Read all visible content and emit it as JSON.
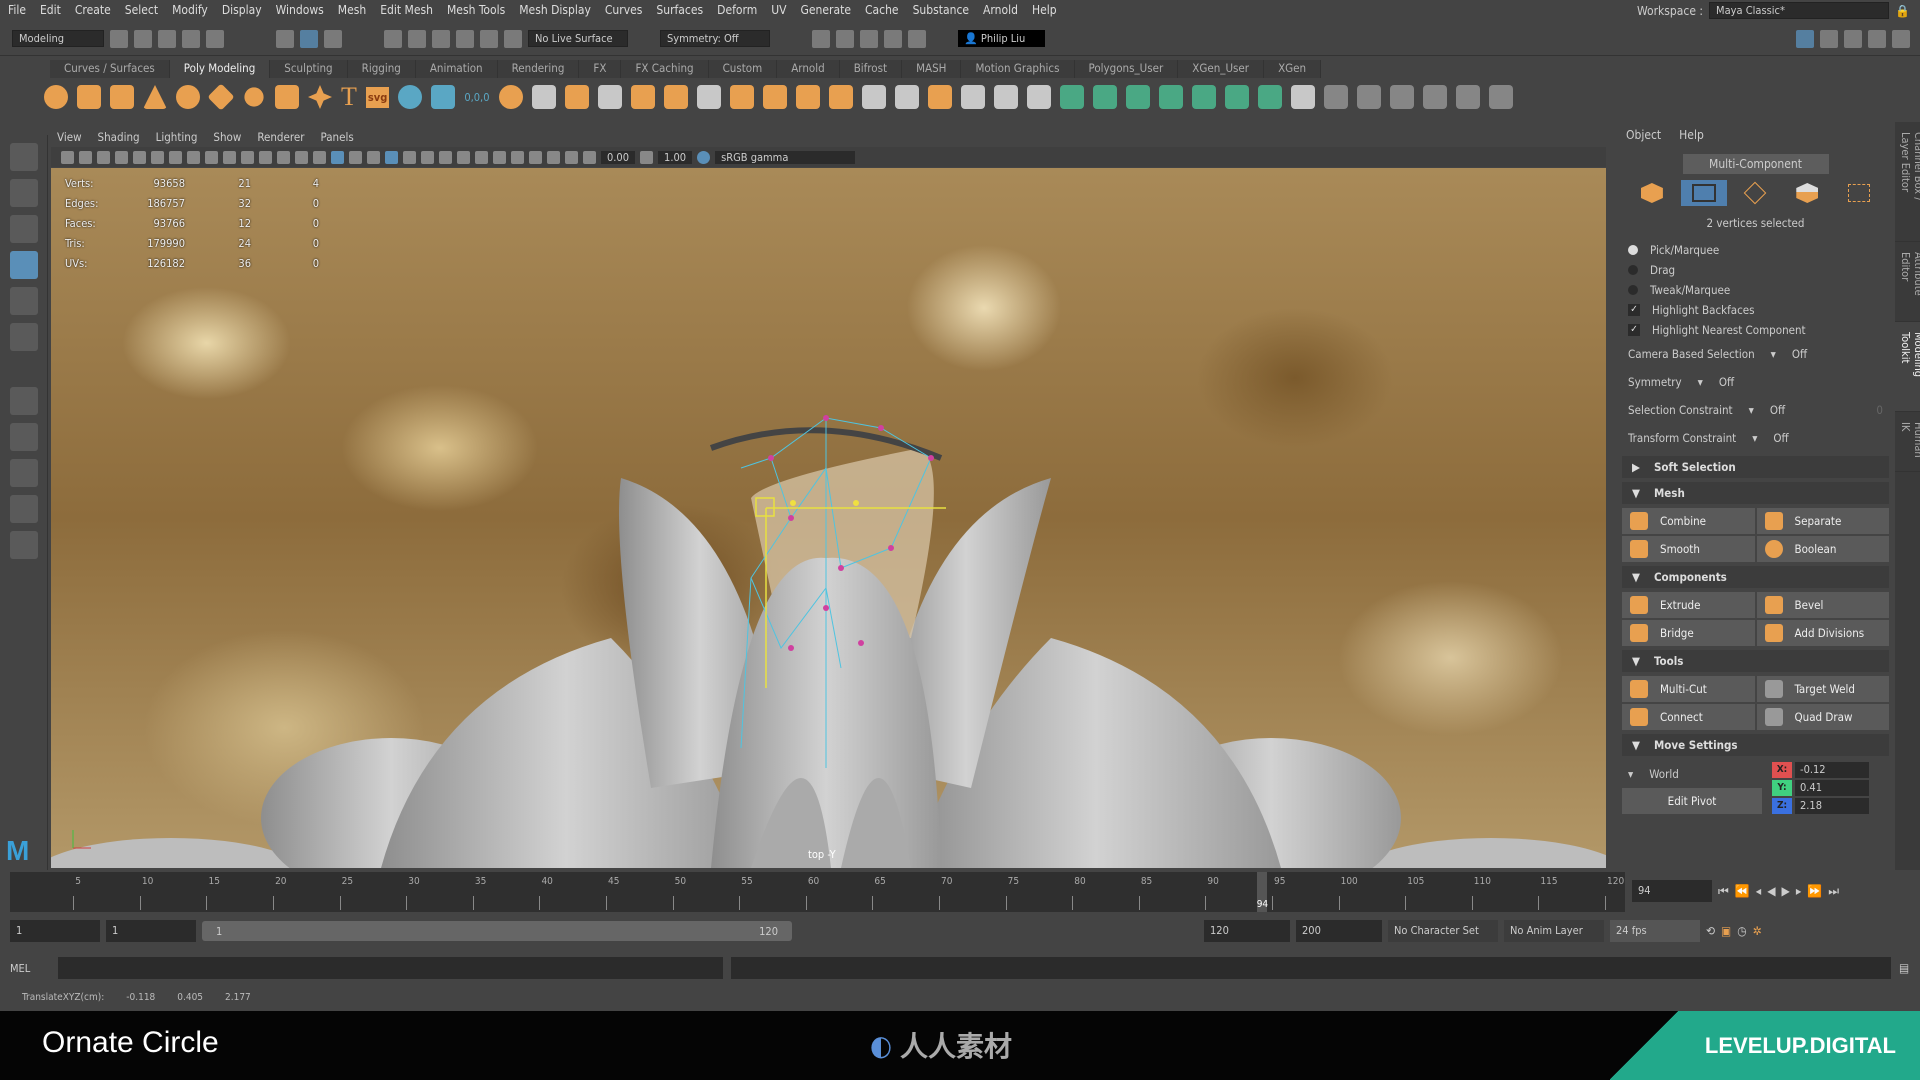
{
  "menubar": {
    "items": [
      "File",
      "Edit",
      "Create",
      "Select",
      "Modify",
      "Display",
      "Windows",
      "Mesh",
      "Edit Mesh",
      "Mesh Tools",
      "Mesh Display",
      "Curves",
      "Surfaces",
      "Deform",
      "UV",
      "Generate",
      "Cache",
      "Substance",
      "Arnold",
      "Help"
    ],
    "workspace_label": "Workspace :",
    "workspace_value": "Maya Classic*"
  },
  "statusline": {
    "mode": "Modeling",
    "live_surface": "No Live Surface",
    "symmetry": "Symmetry: Off",
    "user": "Philip Liu"
  },
  "shelf": {
    "tabs": [
      "Curves / Surfaces",
      "Poly Modeling",
      "Sculpting",
      "Rigging",
      "Animation",
      "Rendering",
      "FX",
      "FX Caching",
      "Custom",
      "Arnold",
      "Bifrost",
      "MASH",
      "Motion Graphics",
      "Polygons_User",
      "XGen_User",
      "XGen"
    ],
    "active": "Poly Modeling",
    "svg_label": "svg",
    "text_label": "T",
    "origin_label": "0,0,0"
  },
  "viewport": {
    "menu": [
      "View",
      "Shading",
      "Lighting",
      "Show",
      "Renderer",
      "Panels"
    ],
    "exposure": "0.00",
    "gamma": "1.00",
    "colorspace": "sRGB gamma",
    "camera": "top -Y",
    "hud": [
      [
        "Verts:",
        "93658",
        "21",
        "4"
      ],
      [
        "Edges:",
        "186757",
        "32",
        "0"
      ],
      [
        "Faces:",
        "93766",
        "12",
        "0"
      ],
      [
        "Tris:",
        "179990",
        "24",
        "0"
      ],
      [
        "UVs:",
        "126182",
        "36",
        "0"
      ]
    ]
  },
  "toolkit": {
    "menu": [
      "Object",
      "Help"
    ],
    "multi_component": "Multi-Component",
    "selection_info": "2 vertices selected",
    "modes": [
      {
        "label": "Pick/Marquee",
        "on": true
      },
      {
        "label": "Drag",
        "on": false
      },
      {
        "label": "Tweak/Marquee",
        "on": false
      }
    ],
    "checks": [
      {
        "label": "Highlight Backfaces",
        "checked": true
      },
      {
        "label": "Highlight Nearest Component",
        "checked": true
      }
    ],
    "options": [
      {
        "label": "Camera Based Selection",
        "value": "Off"
      },
      {
        "label": "Symmetry",
        "value": "Off"
      },
      {
        "label": "Selection Constraint",
        "value": "Off",
        "extra": "0"
      },
      {
        "label": "Transform Constraint",
        "value": "Off"
      }
    ],
    "soft_selection": "Soft Selection",
    "mesh": {
      "title": "Mesh",
      "buttons": [
        "Combine",
        "Separate",
        "Smooth",
        "Boolean"
      ]
    },
    "components": {
      "title": "Components",
      "buttons": [
        "Extrude",
        "Bevel",
        "Bridge",
        "Add Divisions"
      ]
    },
    "tools": {
      "title": "Tools",
      "buttons": [
        "Multi-Cut",
        "Target Weld",
        "Connect",
        "Quad Draw"
      ]
    },
    "move": {
      "title": "Move Settings",
      "space": "World",
      "edit_pivot": "Edit Pivot",
      "x_label": "X:",
      "y_label": "Y:",
      "z_label": "Z:",
      "x": "-0.12",
      "y": "0.41",
      "z": "2.18"
    },
    "side_tabs": [
      "Channel Box / Layer Editor",
      "Attribute Editor",
      "Modeling Toolkit",
      "Human IK"
    ],
    "active_side_tab": "Modeling Toolkit"
  },
  "timeline": {
    "ticks": [
      "5",
      "10",
      "15",
      "20",
      "25",
      "30",
      "35",
      "40",
      "45",
      "50",
      "55",
      "60",
      "65",
      "70",
      "75",
      "80",
      "85",
      "90",
      "95",
      "100",
      "105",
      "110",
      "115",
      "120"
    ],
    "current": "94",
    "current_field": "94",
    "start": 1,
    "end": 120
  },
  "range": {
    "start": "1",
    "playback_start": "1",
    "slider_start": "1",
    "slider_end": "120",
    "playback_end": "120",
    "end": "200",
    "character_set": "No Character Set",
    "anim_layer": "No Anim Layer",
    "fps": "24 fps"
  },
  "mel": {
    "label": "MEL"
  },
  "help": {
    "label": "TranslateXYZ(cm):",
    "x": "-0.118",
    "y": "0.405",
    "z": "2.177"
  },
  "banner": {
    "title": "Ornate Circle",
    "brand": "LEVELUP.DIGITAL",
    "center_logo": "人人素材"
  },
  "colors": {
    "accent_blue": "#5a8fb8",
    "shelf_orange": "#e8a050",
    "brand_teal": "#22a98b",
    "x_red": "#e05050",
    "y_green": "#40d080",
    "z_blue": "#3a70e0"
  }
}
